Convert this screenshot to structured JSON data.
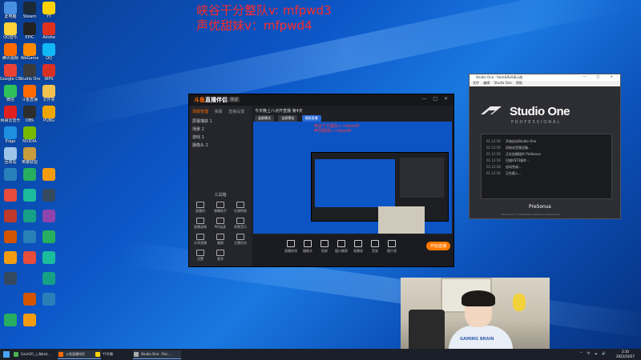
{
  "overlay": {
    "line1": "峡谷干分整队v: mfpwd3",
    "line2": "声优甜妹v：mfpwd4"
  },
  "desktop_icons": [
    {
      "label": "此电脑",
      "color": "#4a90e2"
    },
    {
      "label": "QQ音乐",
      "color": "#ffd23a"
    },
    {
      "label": "腾讯视频",
      "color": "#ff6a00"
    },
    {
      "label": "Google Chrome",
      "color": "#e94235"
    },
    {
      "label": "微信",
      "color": "#2ec15b"
    },
    {
      "label": "网易云音乐",
      "color": "#e02020"
    },
    {
      "label": "Edge",
      "color": "#1f8fe0"
    },
    {
      "label": "回收站",
      "color": "#9fc4ea"
    },
    {
      "label": "Steam",
      "color": "#1b2838"
    },
    {
      "label": "EPIC",
      "color": "#222222"
    },
    {
      "label": "WeGame",
      "color": "#ff8a00"
    },
    {
      "label": "Studio One",
      "color": "#3a3a3a"
    },
    {
      "label": "斗鱼直播",
      "color": "#ff6a00"
    },
    {
      "label": "OBS",
      "color": "#2d2d2d"
    },
    {
      "label": "NVIDIA",
      "color": "#76b900"
    },
    {
      "label": "英雄联盟",
      "color": "#c89b3c"
    },
    {
      "label": "YY",
      "color": "#ffd200"
    },
    {
      "label": "Adobe",
      "color": "#e0301e"
    },
    {
      "label": "QQ",
      "color": "#12b7f5"
    },
    {
      "label": "WPS",
      "color": "#d93025"
    },
    {
      "label": "文件夹",
      "color": "#f2c14e"
    },
    {
      "label": "PUBG",
      "color": "#f0a500"
    }
  ],
  "live_app": {
    "logo_prefix": "斗鱼",
    "logo_suffix": "直播伴侣",
    "badge": "测试",
    "tabs": [
      "场景管理",
      "弹幕",
      "直播设置"
    ],
    "scenes": [
      "屏幕捕获 1",
      "场景 2",
      "游戏 1",
      "摄像头 2"
    ],
    "tools_header": "工具箱",
    "tools": [
      "直播间",
      "弹幕助手",
      "礼物特效",
      "直播录制",
      "PK/连麦",
      "背景音乐",
      "分享直播",
      "美颜",
      "主播任务",
      "设置",
      "更多"
    ],
    "header": "今天晚上八点开直播 第4天",
    "buttons": [
      "竖屏模式",
      "全屏预览",
      "横屏直播"
    ],
    "preview_text_1": "峡谷干分整队v: mfpwd3",
    "preview_text_2": "声优甜妹v: mfpwd4",
    "bottom_buttons": [
      "直播房间",
      "摄像头",
      "投屏",
      "窗口捕获",
      "直播录",
      "音效",
      "图片视"
    ],
    "go_live": "开始直播"
  },
  "studio_one": {
    "title": "Studio One - Rock&Roll演示曲",
    "menu": [
      "文件",
      "编辑",
      "Studio One",
      "帮助"
    ],
    "brand": "Studio One",
    "edition": "PROFESSIONAL",
    "log": [
      {
        "time": "01:12:56",
        "msg": "开始启动Studio One"
      },
      {
        "time": "01:12:56",
        "msg": "初始化音频设备..."
      },
      {
        "time": "01:12:56",
        "msg": "正在加载插件 PreSonus"
      },
      {
        "time": "01:12:56",
        "msg": "扫描VST3插件..."
      },
      {
        "time": "01:12:56",
        "msg": "启动完成..."
      },
      {
        "time": "01:12:56",
        "msg": "正在载入..."
      }
    ],
    "maker": "PreSonus",
    "copyright": "Studio One © 2009-2020 PreSonus Software Ltd."
  },
  "webcam": {
    "shirt_text": "GAMING BRAIN"
  },
  "taskbar": {
    "items": [
      {
        "label": "Gaint20_上海kad...",
        "color": "#4caf50"
      },
      {
        "label": "斗鱼直播伴侣",
        "color": "#ff6a00"
      },
      {
        "label": "YY开播",
        "color": "#ffd200"
      },
      {
        "label": "Studio One - Roc...",
        "color": "#aaaaaa"
      }
    ],
    "time": "2:10",
    "date": "2022/10/27",
    "tray": "^ 中 ☁ 🔊"
  }
}
